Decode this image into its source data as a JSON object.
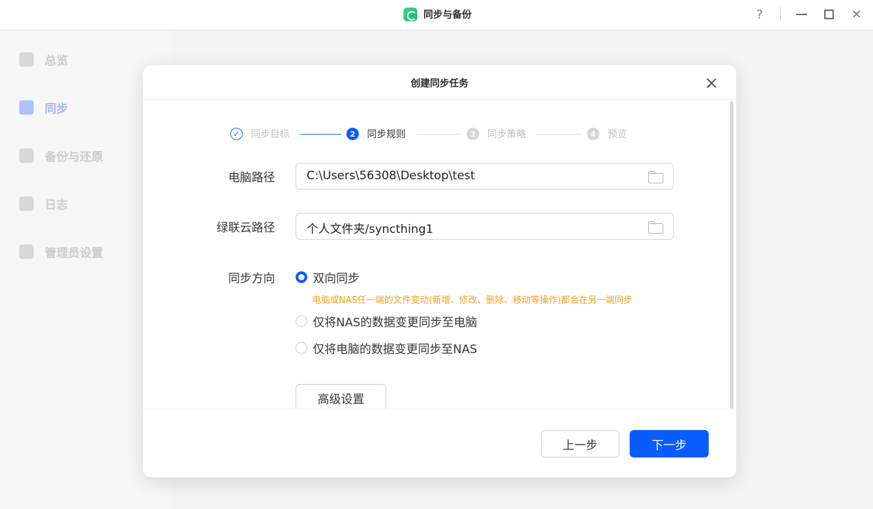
{
  "app": {
    "title": "同步与备份",
    "help_glyph": "?",
    "close_glyph": "✕"
  },
  "sidebar": {
    "items": [
      {
        "label": "总览",
        "icon": "chart-icon",
        "active": false
      },
      {
        "label": "同步",
        "icon": "sync-arrows-icon",
        "active": true
      },
      {
        "label": "备份与还原",
        "icon": "backup-icon",
        "active": false
      },
      {
        "label": "日志",
        "icon": "log-book-icon",
        "active": false
      },
      {
        "label": "管理员设置",
        "icon": "gear-icon",
        "active": false
      }
    ]
  },
  "dialog": {
    "title": "创建同步任务",
    "steps": [
      {
        "num": "✓",
        "label": "同步目标",
        "state": "done"
      },
      {
        "num": "2",
        "label": "同步规则",
        "state": "current"
      },
      {
        "num": "3",
        "label": "同步策略",
        "state": "todo"
      },
      {
        "num": "4",
        "label": "预览",
        "state": "todo"
      }
    ],
    "form": {
      "pc_path_label": "电脑路径",
      "pc_path_value": "C:\\Users\\56308\\Desktop\\test",
      "cloud_path_label": "绿联云路径",
      "cloud_path_value": "个人文件夹/syncthing1",
      "direction_label": "同步方向",
      "options": [
        {
          "label": "双向同步",
          "checked": true
        },
        {
          "label": "仅将NAS的数据变更同步至电脑",
          "checked": false
        },
        {
          "label": "仅将电脑的数据变更同步至NAS",
          "checked": false
        }
      ],
      "hint": "电脑或NAS任一端的文件变动(新增、修改、删除、移动等操作)都会在另一端同步",
      "advanced_label": "高级设置"
    },
    "footer": {
      "prev_label": "上一步",
      "next_label": "下一步"
    }
  },
  "colors": {
    "accent": "#0b5cff",
    "hint": "#f0a020",
    "logo": "#2ecc71"
  }
}
